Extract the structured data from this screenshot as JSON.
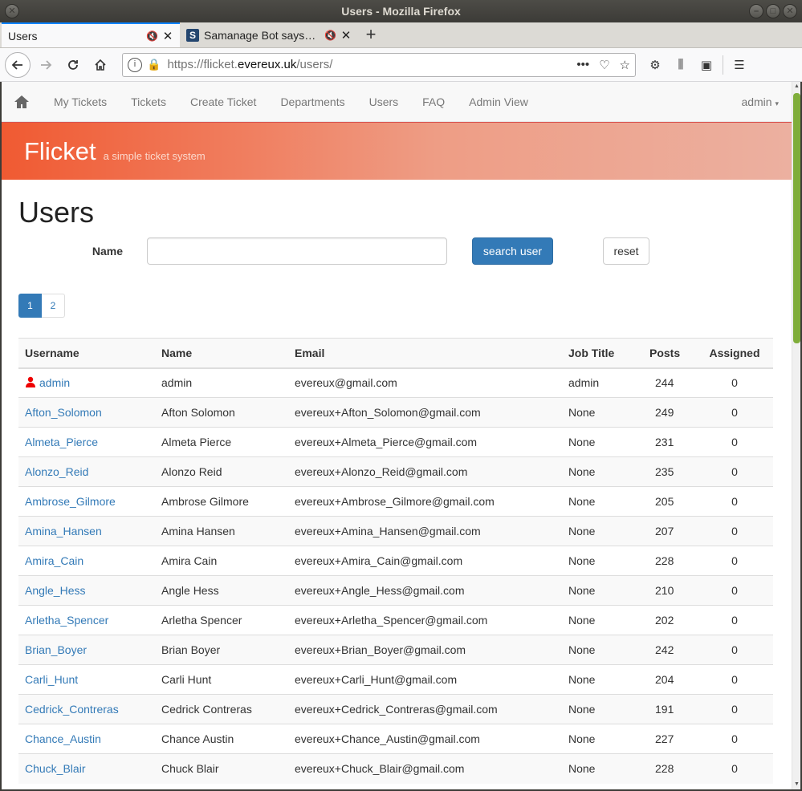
{
  "window": {
    "title": "Users - Mozilla Firefox"
  },
  "tabs": [
    {
      "label": "Users",
      "active": true
    },
    {
      "label": "Samanage Bot says…",
      "active": false
    }
  ],
  "urlbar": {
    "prefix": "https://flicket.",
    "domain": "evereux.uk",
    "path": "/users/"
  },
  "nav": {
    "links": [
      "My Tickets",
      "Tickets",
      "Create Ticket",
      "Departments",
      "Users",
      "FAQ",
      "Admin View"
    ],
    "user_menu": "admin"
  },
  "banner": {
    "brand": "Flicket",
    "tagline": "a simple ticket system"
  },
  "page": {
    "title": "Users"
  },
  "search": {
    "label": "Name",
    "placeholder": "",
    "value": "",
    "search_button": "search user",
    "reset_button": "reset"
  },
  "pagination": {
    "pages": [
      "1",
      "2"
    ],
    "current": "1"
  },
  "table": {
    "headers": [
      "Username",
      "Name",
      "Email",
      "Job Title",
      "Posts",
      "Assigned"
    ],
    "rows": [
      {
        "username": "admin",
        "name": "admin",
        "email": "evereux@gmail.com",
        "job": "admin",
        "posts": "244",
        "assigned": "0",
        "is_admin": true
      },
      {
        "username": "Afton_Solomon",
        "name": "Afton Solomon",
        "email": "evereux+Afton_Solomon@gmail.com",
        "job": "None",
        "posts": "249",
        "assigned": "0"
      },
      {
        "username": "Almeta_Pierce",
        "name": "Almeta Pierce",
        "email": "evereux+Almeta_Pierce@gmail.com",
        "job": "None",
        "posts": "231",
        "assigned": "0"
      },
      {
        "username": "Alonzo_Reid",
        "name": "Alonzo Reid",
        "email": "evereux+Alonzo_Reid@gmail.com",
        "job": "None",
        "posts": "235",
        "assigned": "0"
      },
      {
        "username": "Ambrose_Gilmore",
        "name": "Ambrose Gilmore",
        "email": "evereux+Ambrose_Gilmore@gmail.com",
        "job": "None",
        "posts": "205",
        "assigned": "0"
      },
      {
        "username": "Amina_Hansen",
        "name": "Amina Hansen",
        "email": "evereux+Amina_Hansen@gmail.com",
        "job": "None",
        "posts": "207",
        "assigned": "0"
      },
      {
        "username": "Amira_Cain",
        "name": "Amira Cain",
        "email": "evereux+Amira_Cain@gmail.com",
        "job": "None",
        "posts": "228",
        "assigned": "0"
      },
      {
        "username": "Angle_Hess",
        "name": "Angle Hess",
        "email": "evereux+Angle_Hess@gmail.com",
        "job": "None",
        "posts": "210",
        "assigned": "0"
      },
      {
        "username": "Arletha_Spencer",
        "name": "Arletha Spencer",
        "email": "evereux+Arletha_Spencer@gmail.com",
        "job": "None",
        "posts": "202",
        "assigned": "0"
      },
      {
        "username": "Brian_Boyer",
        "name": "Brian Boyer",
        "email": "evereux+Brian_Boyer@gmail.com",
        "job": "None",
        "posts": "242",
        "assigned": "0"
      },
      {
        "username": "Carli_Hunt",
        "name": "Carli Hunt",
        "email": "evereux+Carli_Hunt@gmail.com",
        "job": "None",
        "posts": "204",
        "assigned": "0"
      },
      {
        "username": "Cedrick_Contreras",
        "name": "Cedrick Contreras",
        "email": "evereux+Cedrick_Contreras@gmail.com",
        "job": "None",
        "posts": "191",
        "assigned": "0"
      },
      {
        "username": "Chance_Austin",
        "name": "Chance Austin",
        "email": "evereux+Chance_Austin@gmail.com",
        "job": "None",
        "posts": "227",
        "assigned": "0"
      },
      {
        "username": "Chuck_Blair",
        "name": "Chuck Blair",
        "email": "evereux+Chuck_Blair@gmail.com",
        "job": "None",
        "posts": "228",
        "assigned": "0"
      }
    ]
  },
  "colors": {
    "primary": "#337ab7",
    "banner_start": "#f05a32",
    "banner_end": "#ecb0a0",
    "scroll_thumb": "#7fad3a"
  },
  "icons": [
    "home-icon",
    "user-icon",
    "reload-icon",
    "lock-icon",
    "bookmark-star-icon",
    "pocket-icon",
    "library-icon",
    "sidebar-icon",
    "menu-icon"
  ]
}
